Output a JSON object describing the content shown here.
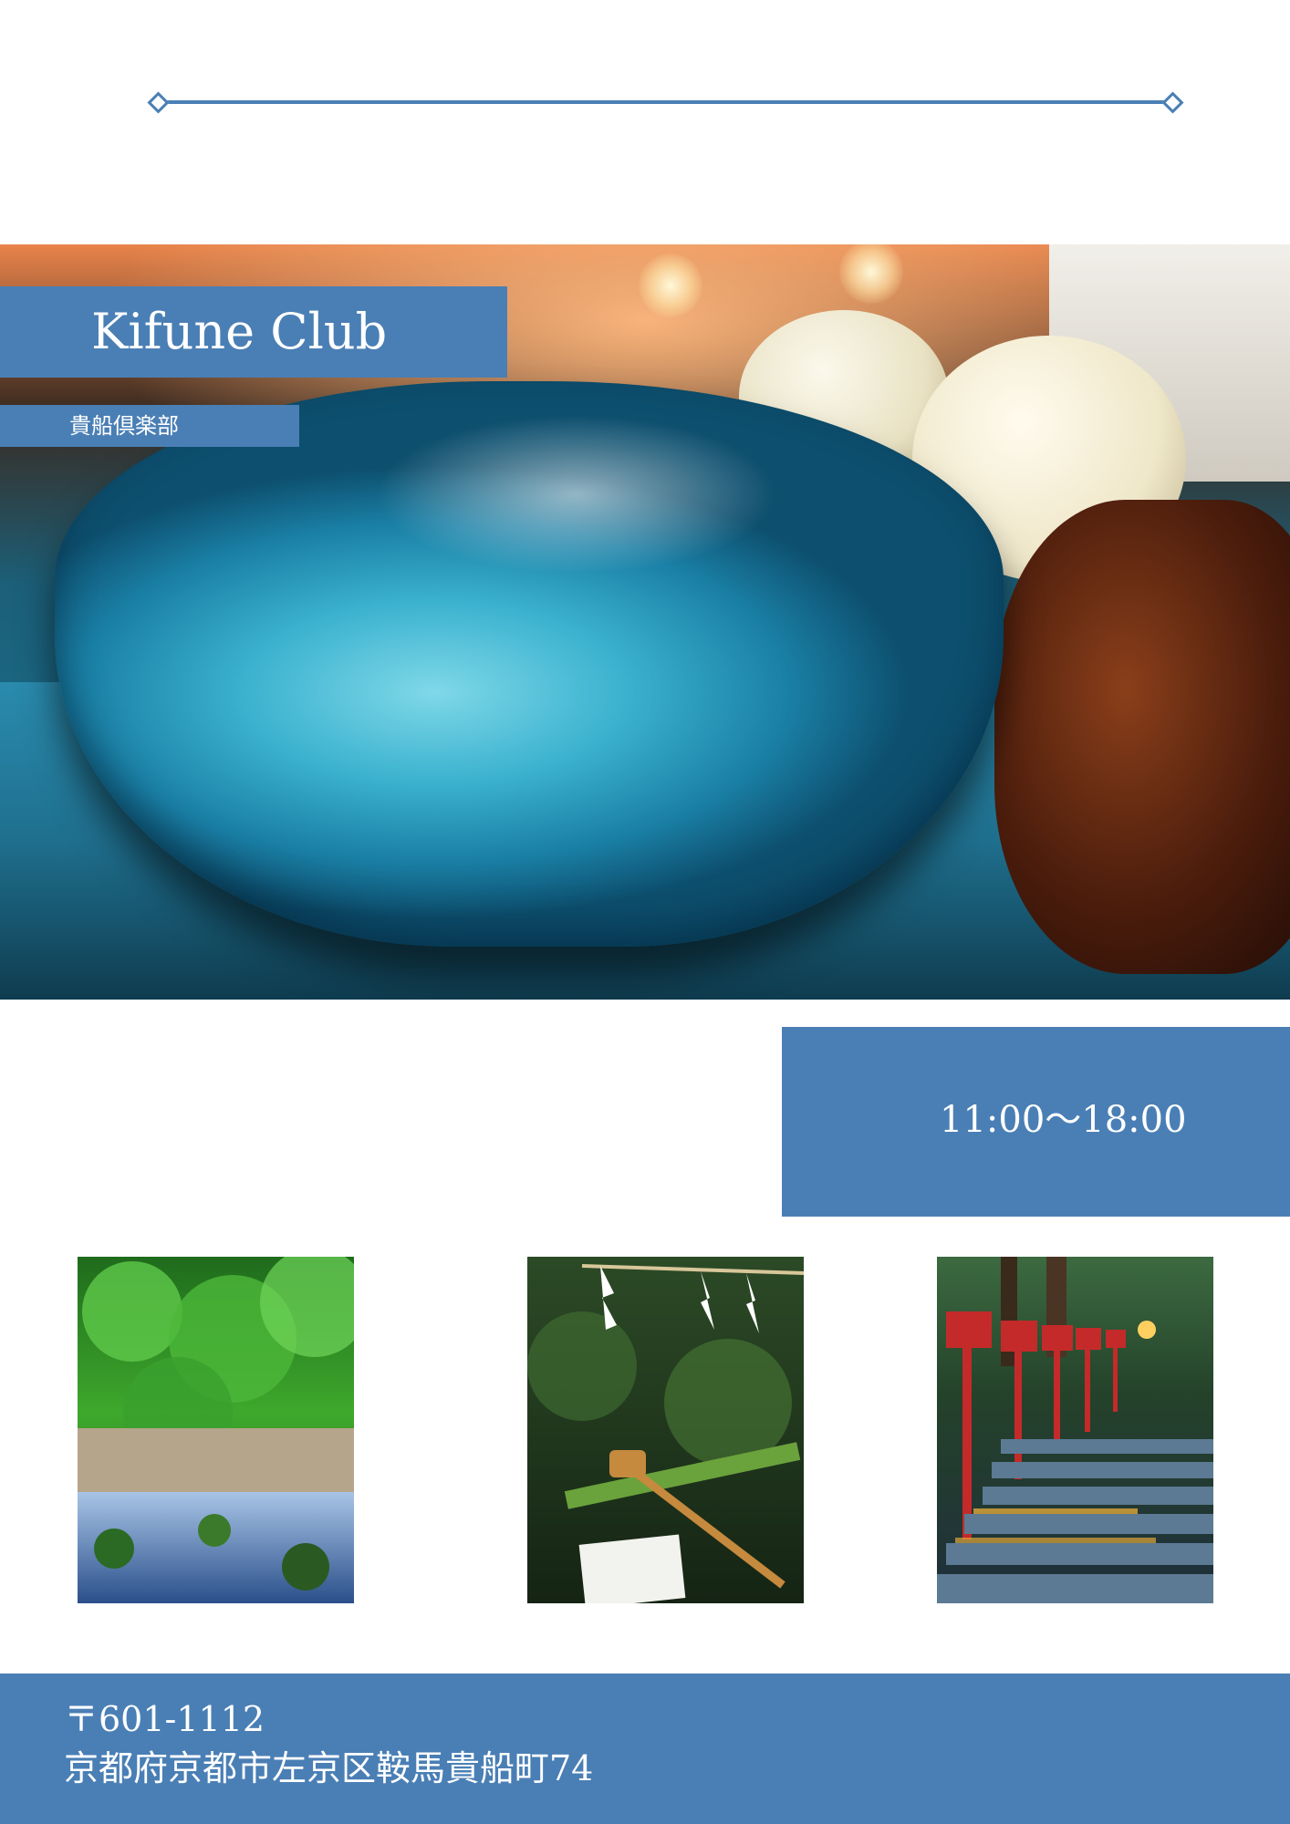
{
  "title": "Kifune Club",
  "subtitle": "貴船倶楽部",
  "hours": "11:00～18:00",
  "footer": {
    "postal": "〒601-1112",
    "address": "京都府京都市左京区鞍馬貴船町74"
  },
  "colors": {
    "accent": "#4a7fb5"
  }
}
